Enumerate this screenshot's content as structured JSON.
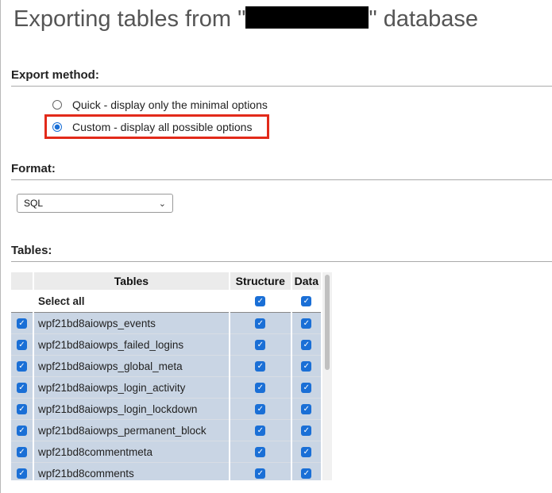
{
  "title": {
    "before": "Exporting tables from \"",
    "after": "\" database"
  },
  "export_method": {
    "label": "Export method:",
    "options": [
      {
        "label": "Quick - display only the minimal options",
        "selected": false
      },
      {
        "label": "Custom - display all possible options",
        "selected": true
      }
    ]
  },
  "format": {
    "label": "Format:",
    "selected": "SQL"
  },
  "tables": {
    "label": "Tables:",
    "columns": [
      "Tables",
      "Structure",
      "Data"
    ],
    "select_all": "Select all",
    "rows": [
      {
        "name": "wpf21bd8aiowps_events"
      },
      {
        "name": "wpf21bd8aiowps_failed_logins"
      },
      {
        "name": "wpf21bd8aiowps_global_meta"
      },
      {
        "name": "wpf21bd8aiowps_login_activity"
      },
      {
        "name": "wpf21bd8aiowps_login_lockdown"
      },
      {
        "name": "wpf21bd8aiowps_permanent_block"
      },
      {
        "name": "wpf21bd8commentmeta"
      },
      {
        "name": "wpf21bd8comments"
      }
    ]
  },
  "icons": {
    "checkbox": "checkbox-checked-icon",
    "dropdown": "chevron-down-icon"
  },
  "colors": {
    "accent": "#1a6fd6",
    "highlight_border": "#e22a1a",
    "row_background": "#c9d5e4"
  }
}
